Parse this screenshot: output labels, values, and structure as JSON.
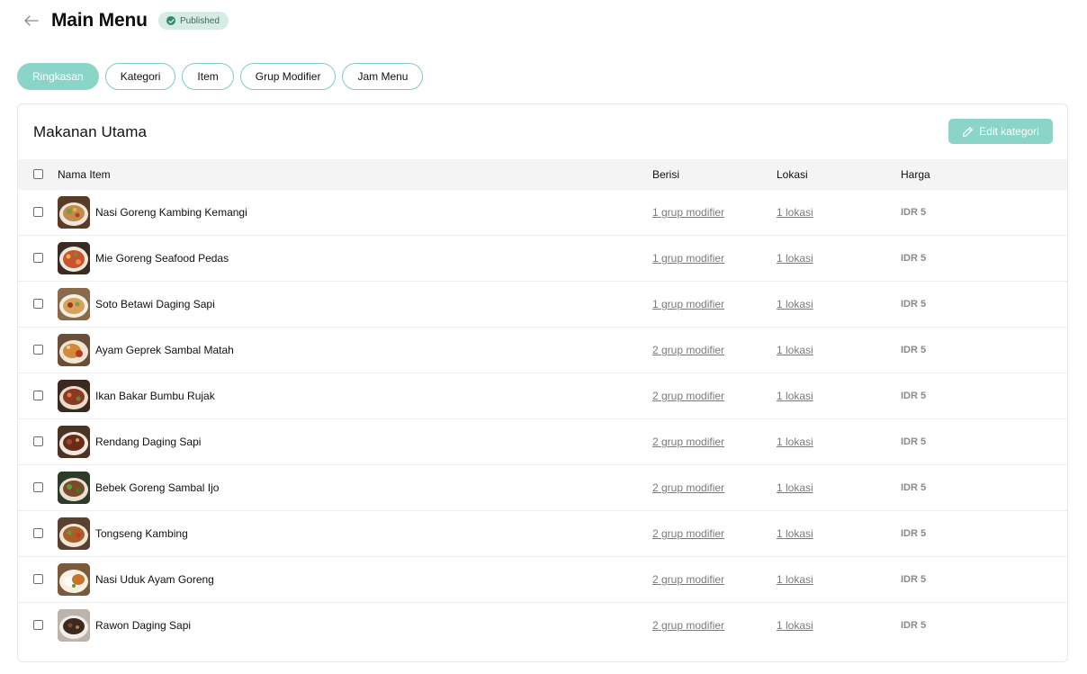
{
  "header": {
    "title": "Main Menu",
    "status": "Published"
  },
  "tabs": [
    {
      "label": "Ringkasan",
      "active": true
    },
    {
      "label": "Kategori",
      "active": false
    },
    {
      "label": "Item",
      "active": false
    },
    {
      "label": "Grup Modifier",
      "active": false
    },
    {
      "label": "Jam Menu",
      "active": false
    }
  ],
  "category": {
    "title": "Makanan Utama",
    "edit_label": "Edit kategori"
  },
  "table": {
    "columns": {
      "name": "Nama Item",
      "contains": "Berisi",
      "location": "Lokasi",
      "price": "Harga"
    },
    "rows": [
      {
        "name": "Nasi Goreng Kambing Kemangi",
        "contains": "1 grup modifier",
        "location": "1 lokasi",
        "price": "IDR 5"
      },
      {
        "name": "Mie Goreng Seafood Pedas",
        "contains": "1 grup modifier",
        "location": "1 lokasi",
        "price": "IDR 5"
      },
      {
        "name": "Soto Betawi Daging Sapi",
        "contains": "1 grup modifier",
        "location": "1 lokasi",
        "price": "IDR 5"
      },
      {
        "name": "Ayam Geprek Sambal Matah",
        "contains": "2 grup modifier",
        "location": "1 lokasi",
        "price": "IDR 5"
      },
      {
        "name": "Ikan Bakar Bumbu Rujak",
        "contains": "2 grup modifier",
        "location": "1 lokasi",
        "price": "IDR 5"
      },
      {
        "name": "Rendang Daging Sapi",
        "contains": "2 grup modifier",
        "location": "1 lokasi",
        "price": "IDR 5"
      },
      {
        "name": "Bebek Goreng Sambal Ijo",
        "contains": "2 grup modifier",
        "location": "1 lokasi",
        "price": "IDR 5"
      },
      {
        "name": "Tongseng Kambing",
        "contains": "2 grup modifier",
        "location": "1 lokasi",
        "price": "IDR 5"
      },
      {
        "name": "Nasi Uduk Ayam Goreng",
        "contains": "2 grup modifier",
        "location": "1 lokasi",
        "price": "IDR 5"
      },
      {
        "name": "Rawon Daging Sapi",
        "contains": "2 grup modifier",
        "location": "1 lokasi",
        "price": "IDR 5"
      }
    ]
  },
  "icons": {
    "back": "arrow-left-icon",
    "status": "check-circle-icon",
    "edit": "pencil-icon"
  },
  "colors": {
    "accent": "#8ad4c8",
    "accent_border": "#80cbbf",
    "badge_bg": "#d6ebe4",
    "badge_text": "#3f6a5d",
    "link": "#7a7a7a"
  }
}
